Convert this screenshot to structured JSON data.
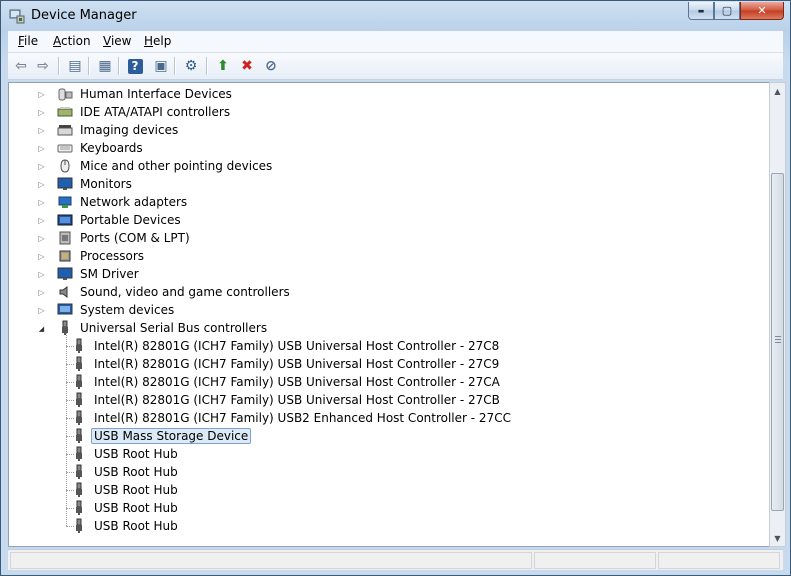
{
  "window": {
    "title": "Device Manager"
  },
  "caption": {
    "minimize": "▬",
    "maximize": "▢",
    "close": "✕"
  },
  "menu": [
    {
      "label_u": "F",
      "label_rest": "ile"
    },
    {
      "label_u": "A",
      "label_rest": "ction"
    },
    {
      "label_u": "V",
      "label_rest": "iew"
    },
    {
      "label_u": "H",
      "label_rest": "elp"
    }
  ],
  "toolbar": [
    {
      "name": "back-icon",
      "glyph": "⇦",
      "color": "#7a8590"
    },
    {
      "name": "forward-icon",
      "glyph": "⇨",
      "color": "#7a8590"
    },
    {
      "name": "console-tree-icon",
      "glyph": "▤",
      "color": "#4b6a8a"
    },
    {
      "name": "properties-icon",
      "glyph": "▦",
      "color": "#4b6a8a"
    },
    {
      "name": "help-icon",
      "glyph": "?",
      "color": "#ffffff"
    },
    {
      "name": "show-hide-pane-icon",
      "glyph": "▣",
      "color": "#4b6a8a"
    },
    {
      "name": "scan-hardware-icon",
      "glyph": "⚙",
      "color": "#355a86"
    },
    {
      "name": "update-driver-icon",
      "glyph": "⬆",
      "color": "#2f8a2f"
    },
    {
      "name": "uninstall-icon",
      "glyph": "✖",
      "color": "#cc2222"
    },
    {
      "name": "disable-icon",
      "glyph": "⊘",
      "color": "#4b6a8a"
    }
  ],
  "tree": {
    "categories": [
      {
        "label": "Human Interface Devices",
        "icon": "hid-icon",
        "expanded": false
      },
      {
        "label": "IDE ATA/ATAPI controllers",
        "icon": "ide-controller-icon",
        "expanded": false
      },
      {
        "label": "Imaging devices",
        "icon": "scanner-icon",
        "expanded": false
      },
      {
        "label": "Keyboards",
        "icon": "keyboard-icon",
        "expanded": false
      },
      {
        "label": "Mice and other pointing devices",
        "icon": "mouse-icon",
        "expanded": false
      },
      {
        "label": "Monitors",
        "icon": "monitor-icon",
        "expanded": false
      },
      {
        "label": "Network adapters",
        "icon": "network-adapter-icon",
        "expanded": false
      },
      {
        "label": "Portable Devices",
        "icon": "portable-device-icon",
        "expanded": false
      },
      {
        "label": "Ports (COM & LPT)",
        "icon": "port-icon",
        "expanded": false
      },
      {
        "label": "Processors",
        "icon": "processor-icon",
        "expanded": false
      },
      {
        "label": "SM Driver",
        "icon": "sm-driver-icon",
        "expanded": false
      },
      {
        "label": "Sound, video and game controllers",
        "icon": "speaker-icon",
        "expanded": false
      },
      {
        "label": "System devices",
        "icon": "system-device-icon",
        "expanded": false
      },
      {
        "label": "Universal Serial Bus controllers",
        "icon": "usb-icon",
        "expanded": true
      }
    ],
    "usb_children": [
      {
        "label": "Intel(R) 82801G (ICH7 Family) USB Universal Host Controller - 27C8",
        "selected": false
      },
      {
        "label": "Intel(R) 82801G (ICH7 Family) USB Universal Host Controller - 27C9",
        "selected": false
      },
      {
        "label": "Intel(R) 82801G (ICH7 Family) USB Universal Host Controller - 27CA",
        "selected": false
      },
      {
        "label": "Intel(R) 82801G (ICH7 Family) USB Universal Host Controller - 27CB",
        "selected": false
      },
      {
        "label": "Intel(R) 82801G (ICH7 Family) USB2 Enhanced Host Controller - 27CC",
        "selected": false
      },
      {
        "label": "USB Mass Storage Device",
        "selected": true
      },
      {
        "label": "USB Root Hub",
        "selected": false
      },
      {
        "label": "USB Root Hub",
        "selected": false
      },
      {
        "label": "USB Root Hub",
        "selected": false
      },
      {
        "label": "USB Root Hub",
        "selected": false
      },
      {
        "label": "USB Root Hub",
        "selected": false
      }
    ]
  },
  "scrollbar": {
    "up": "▲",
    "down": "▼"
  },
  "colors": {
    "selection_bg": "#dce9f7",
    "selection_border": "#7da2ce",
    "close_red": "#c33d22"
  }
}
